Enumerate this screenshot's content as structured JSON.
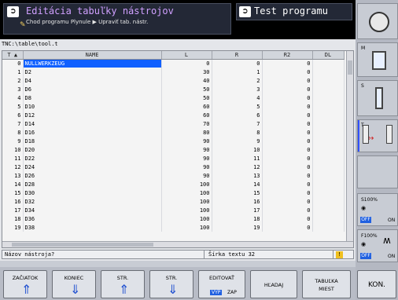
{
  "header": {
    "title": "Editácia tabuľky nástrojov",
    "subtitle": "Chod programu Plynule ▶ Upraviť tab. nástr.",
    "right_title": "Test programu"
  },
  "path": "TNC:\\table\\tool.t",
  "columns": [
    "T",
    "NAME",
    "L",
    "R",
    "R2",
    "DL"
  ],
  "rows": [
    {
      "t": "0",
      "name": "NULLWERKZEUG",
      "l": "0",
      "r": "0",
      "r2": "0",
      "selected": true
    },
    {
      "t": "1",
      "name": "D2",
      "l": "30",
      "r": "1",
      "r2": "0"
    },
    {
      "t": "2",
      "name": "D4",
      "l": "40",
      "r": "2",
      "r2": "0"
    },
    {
      "t": "3",
      "name": "D6",
      "l": "50",
      "r": "3",
      "r2": "0"
    },
    {
      "t": "4",
      "name": "D8",
      "l": "50",
      "r": "4",
      "r2": "0"
    },
    {
      "t": "5",
      "name": "D10",
      "l": "60",
      "r": "5",
      "r2": "0"
    },
    {
      "t": "6",
      "name": "D12",
      "l": "60",
      "r": "6",
      "r2": "0"
    },
    {
      "t": "7",
      "name": "D14",
      "l": "70",
      "r": "7",
      "r2": "0"
    },
    {
      "t": "8",
      "name": "D16",
      "l": "80",
      "r": "8",
      "r2": "0"
    },
    {
      "t": "9",
      "name": "D18",
      "l": "90",
      "r": "9",
      "r2": "0"
    },
    {
      "t": "10",
      "name": "D20",
      "l": "90",
      "r": "10",
      "r2": "0"
    },
    {
      "t": "11",
      "name": "D22",
      "l": "90",
      "r": "11",
      "r2": "0"
    },
    {
      "t": "12",
      "name": "D24",
      "l": "90",
      "r": "12",
      "r2": "0"
    },
    {
      "t": "13",
      "name": "D26",
      "l": "90",
      "r": "13",
      "r2": "0"
    },
    {
      "t": "14",
      "name": "D28",
      "l": "100",
      "r": "14",
      "r2": "0"
    },
    {
      "t": "15",
      "name": "D30",
      "l": "100",
      "r": "15",
      "r2": "0"
    },
    {
      "t": "16",
      "name": "D32",
      "l": "100",
      "r": "16",
      "r2": "0"
    },
    {
      "t": "17",
      "name": "D34",
      "l": "100",
      "r": "17",
      "r2": "0"
    },
    {
      "t": "18",
      "name": "D36",
      "l": "100",
      "r": "18",
      "r2": "0"
    },
    {
      "t": "19",
      "name": "D38",
      "l": "100",
      "r": "19",
      "r2": "0"
    }
  ],
  "status": {
    "question": "Názov nástroja?",
    "width": "Šírka textu 32"
  },
  "right_panel": {
    "m_label": "M",
    "s_label": "S",
    "t_label": "T",
    "s_override": "S100%",
    "f_override": "F100%",
    "off": "OFF",
    "on": "ON"
  },
  "softkeys": {
    "start": "ZAČIATOK",
    "end": "KONIEC",
    "page_up": "STR.",
    "page_down": "STR.",
    "edit": "EDITOVAŤ",
    "edit_off": "VYP",
    "edit_on": "ZAP",
    "search": "HĽADAJ",
    "pocket_table_1": "TABUĽKA",
    "pocket_table_2": "MIEST",
    "end_key": "KON."
  }
}
